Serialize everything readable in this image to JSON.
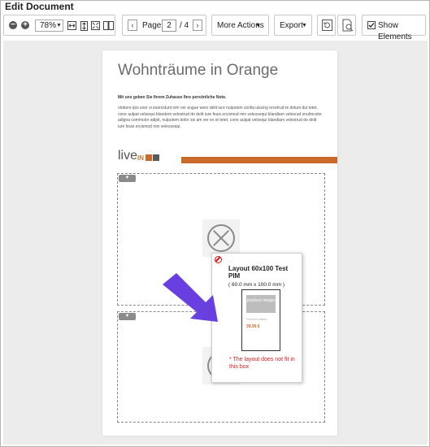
{
  "window": {
    "title": "Edit Document"
  },
  "toolbar": {
    "zoom": "78%",
    "page_label": "Page",
    "page_current": "2",
    "page_total": "/ 4",
    "more_actions": "More Actions",
    "export": "Export",
    "show_elements": "Show Elements",
    "show_elements_checked": true
  },
  "document": {
    "title": "Wohnträume in Orange",
    "subtitle": "Mit uns geben Sie Ihrem Zuhause Ihre persönliche Note.",
    "body": "olobore ipis exer si exercidunt nim ver eugue wero delit iure nulputem zzriliq uiscing ercetrud te dolum dui tetet, cone aulpat velsequi blandem velestrud do delit iure feuis ercismod min velessequi blandiam velesrud onulmcolor adigna commolor adipit, nulputem dolor sis am ver ex et tetet, cone aulpat velsequi blandiam velestrud do delit iure feuis ercismod min velessequi.",
    "logo_live": "live",
    "logo_in": "IN",
    "accent_color": "#c96a2b"
  },
  "popup": {
    "title": "Layout 60x100 Test PIM",
    "dimensions": "( 60.0 mm x 100.0 mm )",
    "preview_image_label": "product image",
    "preview_product_name": "Product Name",
    "preview_price": "39,95 €",
    "warning": "* The layout does not fit in this box",
    "warning_color": "#e01b1b"
  },
  "icons": {
    "zoom_out": "minus-circle-icon",
    "zoom_in": "plus-circle-icon",
    "warning": "forbidden-icon"
  }
}
